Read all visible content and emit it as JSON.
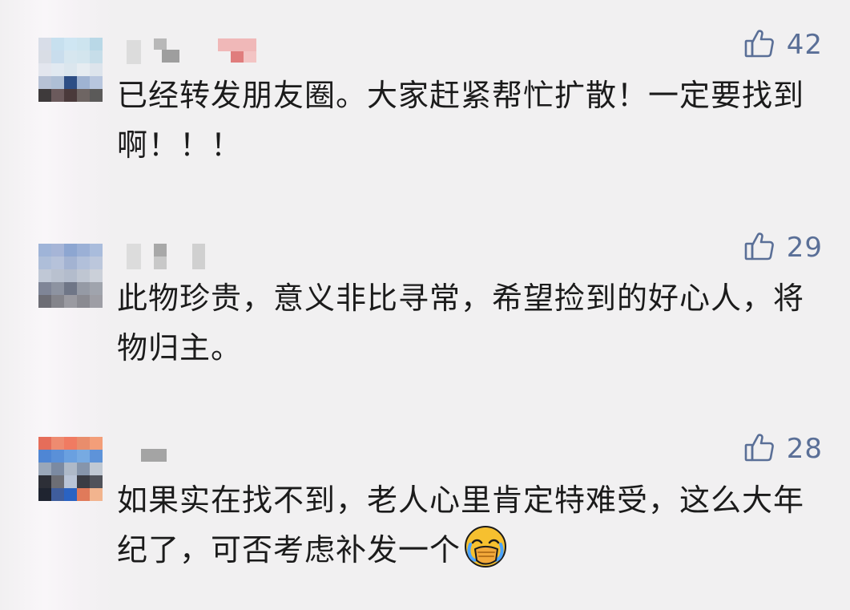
{
  "comments": [
    {
      "avatar_colors": [
        "#d8dde8",
        "#c7e0ef",
        "#cfe6f3",
        "#cde4ef",
        "#b9d8e7",
        "#d9dde5",
        "#c9dded",
        "#d6e6ef",
        "#d3e5ee",
        "#c6dde9",
        "#e3e6ee",
        "#e1e9f1",
        "#dbe6ee",
        "#e6ecf1",
        "#dde4ec",
        "#b7c2d6",
        "#aebfd6",
        "#2d4e85",
        "#9fb3d2",
        "#b8c6de",
        "#3e3a3b",
        "#6b5a5c",
        "#4a3a3b",
        "#6e6563",
        "#5b5a59"
      ],
      "like_count": "42",
      "text": "已经转发朋友圈。大家赶紧帮忙扩散！一定要找到啊！！！"
    },
    {
      "avatar_colors": [
        "#9fb4d8",
        "#a6b5d7",
        "#8da6d1",
        "#9bb0d6",
        "#a9bcdc",
        "#aebed9",
        "#b6c2da",
        "#a3b3d2",
        "#b2c0da",
        "#bcc7dc",
        "#c0c8d6",
        "#b9c1cf",
        "#b3bccc",
        "#bfc6d2",
        "#cbd0d9",
        "#7f8597",
        "#8d93a1",
        "#6f7687",
        "#959aa5",
        "#a0a4ad",
        "#6d6d75",
        "#84848b",
        "#9a9aa1",
        "#8a8a91",
        "#9e9ea5"
      ],
      "like_count": "29",
      "text": "此物珍贵，意义非比寻常，希望捡到的好心人，将物归主。"
    },
    {
      "avatar_colors": [
        "#e56d5a",
        "#ee8b70",
        "#f07b62",
        "#e98d6c",
        "#f39e79",
        "#4f86d4",
        "#5a90d8",
        "#6aa0e0",
        "#77aae2",
        "#5e93d9",
        "#9aa7b9",
        "#7b8aa2",
        "#aeb9c8",
        "#8695ab",
        "#c0c8d3",
        "#2d2f37",
        "#6d6e75",
        "#b9c4d6",
        "#3a3c44",
        "#50525a",
        "#1f2430",
        "#3f5d9c",
        "#2a63c2",
        "#e07a5a",
        "#f2b48e"
      ],
      "like_count": "28",
      "text": "如果实在找不到，老人心里肯定特难受，这么大年纪了，可否考虑补发一个",
      "emoji": "facepalm-emoji"
    }
  ],
  "colors": {
    "background": "#f1f0f1",
    "text": "#1b1b1b",
    "like": "#5a6f97"
  }
}
